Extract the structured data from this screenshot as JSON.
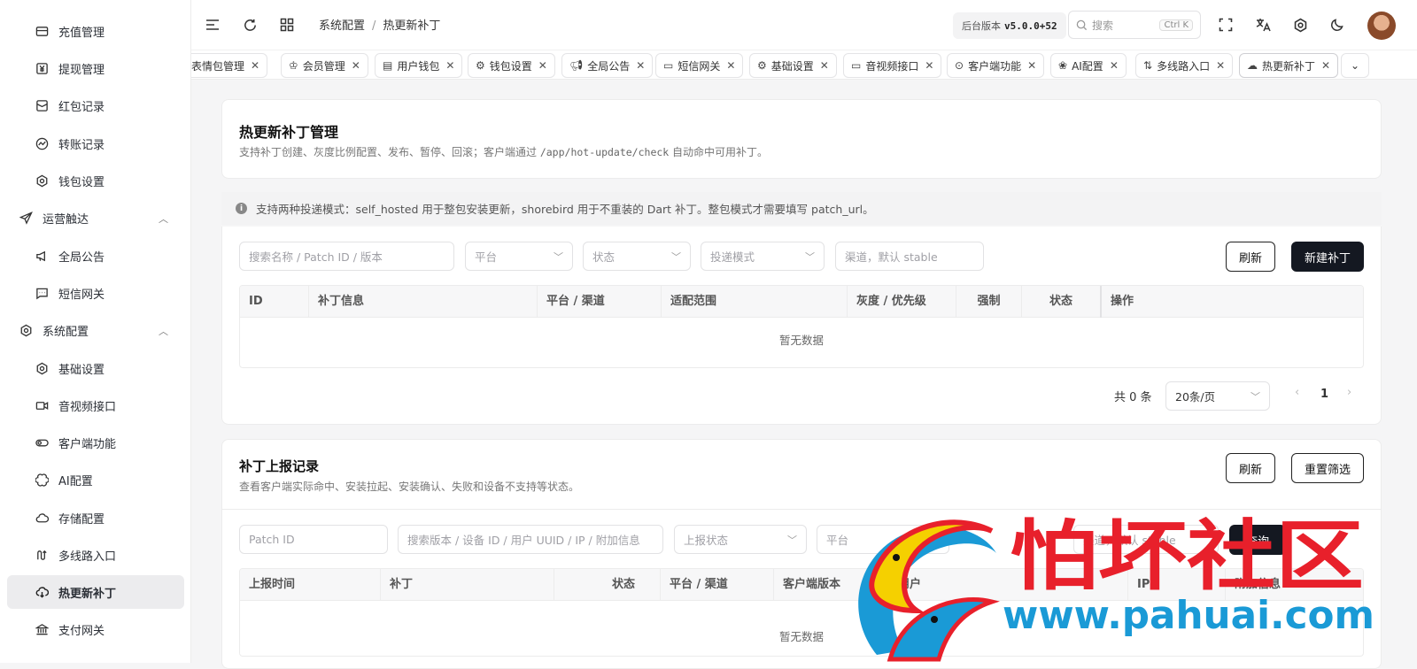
{
  "sidebar": {
    "items": [
      {
        "label": "充值管理",
        "icon": "wallet-icon"
      },
      {
        "label": "提现管理",
        "icon": "yen-icon"
      },
      {
        "label": "红包记录",
        "icon": "envelope-icon"
      },
      {
        "label": "转账记录",
        "icon": "chart-icon"
      },
      {
        "label": "钱包设置",
        "icon": "gear-icon"
      },
      {
        "label": "运营触达",
        "icon": "send-icon",
        "group": true
      },
      {
        "label": "全局公告",
        "icon": "megaphone-icon"
      },
      {
        "label": "短信网关",
        "icon": "message-icon"
      },
      {
        "label": "系统配置",
        "icon": "gear-icon",
        "group": true
      },
      {
        "label": "基础设置",
        "icon": "gear-icon"
      },
      {
        "label": "音视频接口",
        "icon": "video-icon"
      },
      {
        "label": "客户端功能",
        "icon": "toggle-icon"
      },
      {
        "label": "AI配置",
        "icon": "ai-icon"
      },
      {
        "label": "存储配置",
        "icon": "cloud-icon"
      },
      {
        "label": "多线路入口",
        "icon": "route-icon"
      },
      {
        "label": "热更新补丁",
        "icon": "cloud-download-icon",
        "active": true
      },
      {
        "label": "支付网关",
        "icon": "bank-icon"
      }
    ]
  },
  "header": {
    "breadcrumb": [
      "系统配置",
      "热更新补丁"
    ],
    "version_label": "后台版本",
    "version": "v5.0.0+52",
    "search_placeholder": "搜索",
    "search_shortcut": "Ctrl K"
  },
  "tabs": [
    {
      "label": "表情包管理",
      "icon": ""
    },
    {
      "label": "会员管理",
      "icon": "crown-icon"
    },
    {
      "label": "用户钱包",
      "icon": "wallet-icon"
    },
    {
      "label": "钱包设置",
      "icon": "gear-icon"
    },
    {
      "label": "全局公告",
      "icon": "megaphone-icon"
    },
    {
      "label": "短信网关",
      "icon": "message-icon"
    },
    {
      "label": "基础设置",
      "icon": "gear-icon"
    },
    {
      "label": "音视频接口",
      "icon": "video-icon"
    },
    {
      "label": "客户端功能",
      "icon": "toggle-icon"
    },
    {
      "label": "AI配置",
      "icon": "ai-icon"
    },
    {
      "label": "多线路入口",
      "icon": "route-icon"
    },
    {
      "label": "热更新补丁",
      "icon": "cloud-download-icon"
    }
  ],
  "patches": {
    "title": "热更新补丁管理",
    "desc_prefix": "支持补丁创建、灰度比例配置、发布、暂停、回滚；客户端通过 ",
    "desc_code": "/app/hot-update/check",
    "desc_suffix": " 自动命中可用补丁。",
    "notice": "支持两种投递模式：self_hosted 用于整包安装更新，shorebird 用于不重装的 Dart 补丁。整包模式才需要填写 patch_url。",
    "filters": {
      "search": "搜索名称 / Patch ID / 版本",
      "platform": "平台",
      "status": "状态",
      "mode": "投递模式",
      "channel": "渠道，默认 stable"
    },
    "refresh": "刷新",
    "create": "新建补丁",
    "columns": [
      "ID",
      "补丁信息",
      "平台 / 渠道",
      "适配范围",
      "灰度 / 优先级",
      "强制",
      "状态",
      "操作"
    ],
    "empty": "暂无数据",
    "total": "共 0 条",
    "page_size": "20条/页",
    "page": "1"
  },
  "reports": {
    "title": "补丁上报记录",
    "desc": "查看客户端实际命中、安装拉起、安装确认、失败和设备不支持等状态。",
    "refresh": "刷新",
    "reset": "重置筛选",
    "filters": {
      "patch_id": "Patch ID",
      "search": "搜索版本 / 设备 ID / 用户 UUID / IP / 附加信息",
      "report_status": "上报状态",
      "platform": "平台",
      "channel": "渠道，默认 stable"
    },
    "query": "查询",
    "columns": [
      "上报时间",
      "补丁",
      "状态",
      "平台 / 渠道",
      "客户端版本",
      "用户",
      "IP",
      "附加信息"
    ],
    "empty": "暂无数据"
  },
  "watermark": {
    "text": "怕坏社区",
    "url": "www.pahuai.com",
    "colors": {
      "red": "#e8202b",
      "blue": "#1a9ad6",
      "yellow": "#f5d000"
    }
  }
}
